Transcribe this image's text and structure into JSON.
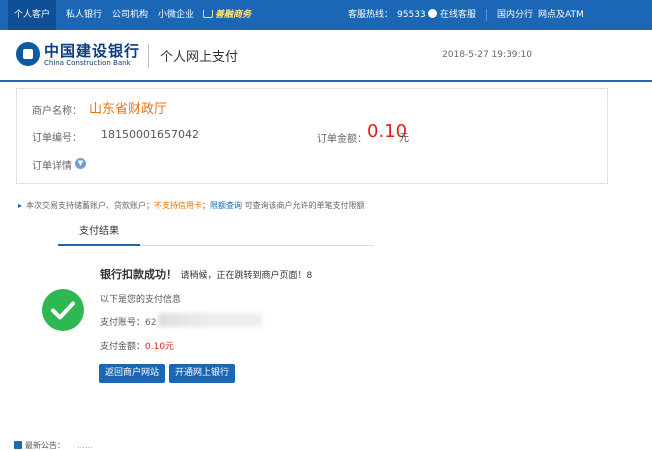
{
  "topnav": {
    "personal": "个人客户",
    "private_bank": "私人银行",
    "company": "公司机构",
    "small_biz": "小微企业",
    "ebuy": "善融商务",
    "hotline_label": "客服热线：",
    "hotline_number": "95533",
    "online_service": "在线客服",
    "branches": "国内分行",
    "atm": "网点及ATM"
  },
  "header": {
    "logo_cn": "中国建设银行",
    "logo_en": "China Construction Bank",
    "title": "个人网上支付",
    "datetime": "2018-5-27 19:39:10"
  },
  "order": {
    "merchant_label": "商户名称：",
    "merchant_name": "山东省财政厅",
    "order_no_label": "订单编号：",
    "order_no": "18150001657042",
    "amount_label": "订单金额：",
    "amount": "0.10",
    "amount_unit": "元",
    "detail_label": "订单详情"
  },
  "notice": {
    "prefix": "本次交易支持储蓄账户、贷款账户；",
    "warn": "不支持信用卡",
    "sep": "；",
    "link": "限额查询",
    "suffix": "可查询该商户允许的单笔支付限额"
  },
  "tab": {
    "label": "支付结果"
  },
  "result": {
    "title": "银行扣款成功！",
    "subtitle": "请稍候，正在跳转到商户页面！8",
    "info_heading": "以下是您的支付信息",
    "account_label": "支付账号：",
    "account_value": "62",
    "amount_label": "支付金额：",
    "amount_value": "0.10元"
  },
  "buttons": {
    "back": "返回商户网站",
    "open_ebank": "开通网上银行"
  },
  "bulletin": {
    "label": "最新公告：",
    "text": "……"
  },
  "colors": {
    "brand_blue": "#1b67b5",
    "success_green": "#2eb851",
    "amount_red": "#e02020",
    "merchant_orange": "#e8730b"
  }
}
